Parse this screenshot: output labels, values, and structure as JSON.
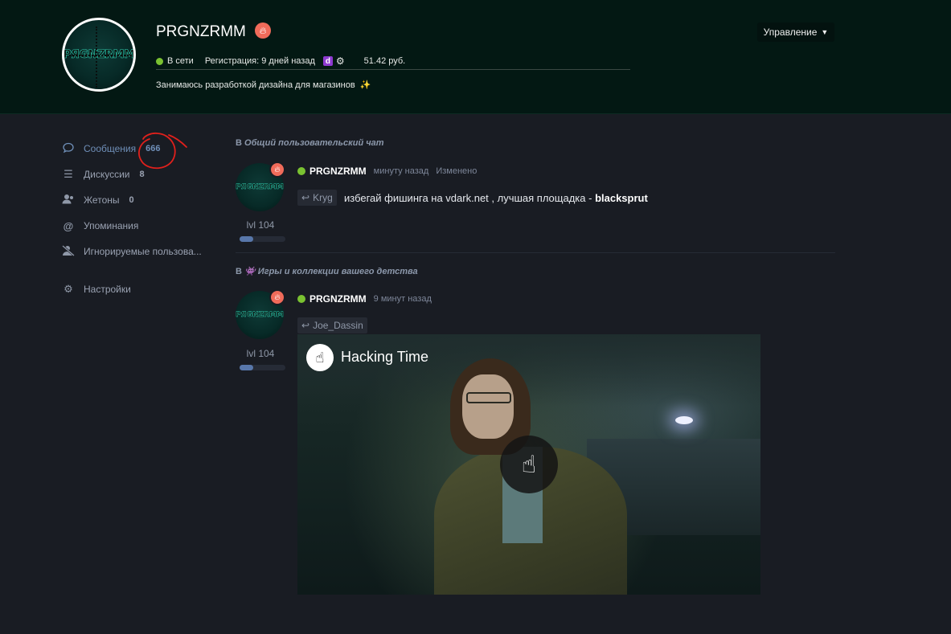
{
  "profile": {
    "username": "PRGNZRMM",
    "avatar_text": "PЯGNZRMM",
    "status": "В сети",
    "registration": "Регистрация: 9 дней назад",
    "role_badge": "d",
    "balance": "51.42 руб.",
    "about": "Занимаюсь разработкой дизайна для магазинов",
    "about_emoji": "✨",
    "manage_label": "Управление"
  },
  "sidebar": {
    "items": [
      {
        "label": "Сообщения",
        "count": "666",
        "icon": "chat-bubble-icon"
      },
      {
        "label": "Дискуссии",
        "count": "8",
        "icon": "list-icon"
      },
      {
        "label": "Жетоны",
        "count": "0",
        "icon": "users-icon"
      },
      {
        "label": "Упоминания",
        "icon": "at-icon"
      },
      {
        "label": "Игнорируемые пользова...",
        "icon": "user-slash-icon"
      },
      {
        "label": "Настройки",
        "icon": "gear-icon"
      }
    ]
  },
  "feed": {
    "posts": [
      {
        "heading_prefix": "В",
        "heading": "Общий пользовательский чат",
        "author": "PRGNZRMM",
        "time": "минуту назад",
        "edited": "Изменено",
        "level": "lvl 104",
        "level_progress": 0.3,
        "reply_to": "Kryg",
        "text": "избегай фишинга на vdark.net , лучшая площадка - ",
        "text_bold": "blacksprut"
      },
      {
        "heading_prefix": "В",
        "heading_emoji": "👾",
        "heading": "Игры и коллекции вашего детства",
        "author": "PRGNZRMM",
        "time": "9 минут назад",
        "level": "lvl 104",
        "level_progress": 0.3,
        "reply_to": "Joe_Dassin",
        "video_title": "Hacking Time"
      }
    ]
  },
  "colors": {
    "header_bg": "#031813",
    "page_bg": "#191c23",
    "online": "#7ac231",
    "accent": "#6f8fb8",
    "fire": "#f06b5a"
  }
}
